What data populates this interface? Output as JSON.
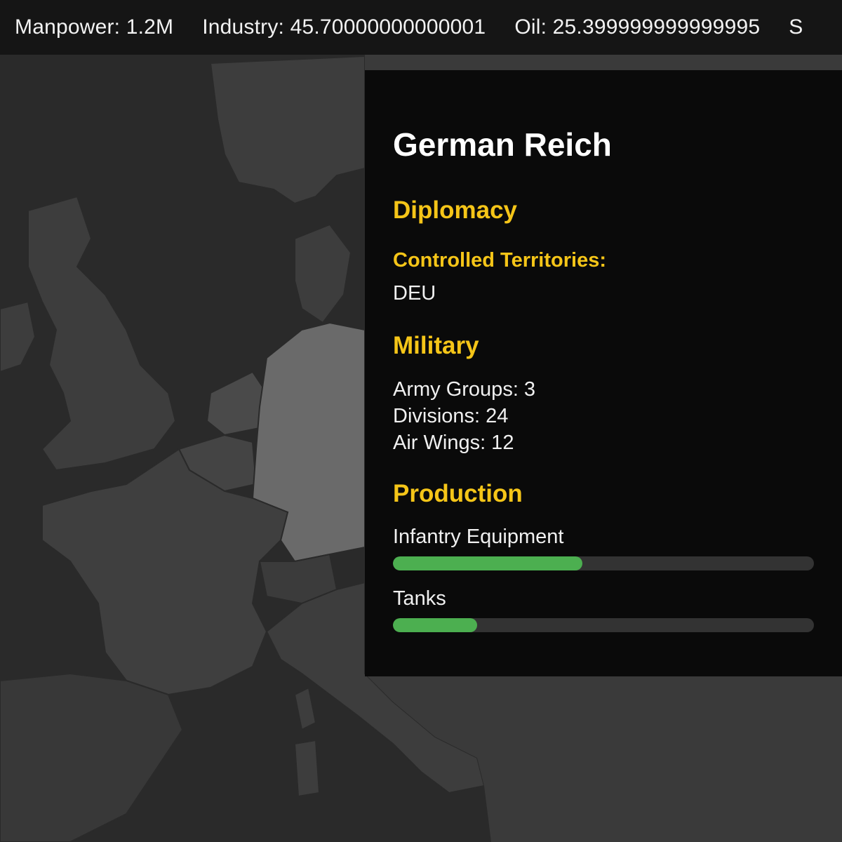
{
  "resources": [
    {
      "label": "Manpower: 1.2M"
    },
    {
      "label": "Industry: 45.70000000000001"
    },
    {
      "label": "Oil: 25.399999999999995"
    },
    {
      "label": "S"
    }
  ],
  "panel": {
    "country_name": "German Reich",
    "diplomacy": {
      "title": "Diplomacy",
      "territories_label": "Controlled Territories:",
      "territories_value": "DEU"
    },
    "military": {
      "title": "Military",
      "lines": [
        "Army Groups: 3",
        "Divisions: 24",
        "Air Wings: 12"
      ]
    },
    "production": {
      "title": "Production",
      "items": [
        {
          "label": "Infantry Equipment",
          "progress": 0.45
        },
        {
          "label": "Tanks",
          "progress": 0.2
        }
      ]
    }
  },
  "colors": {
    "accent": "#f5c518",
    "progress": "#4caf50",
    "highlighted_country": "#6a6a6a",
    "land": "#3c3c3c",
    "sea": "#2a2a2a"
  }
}
